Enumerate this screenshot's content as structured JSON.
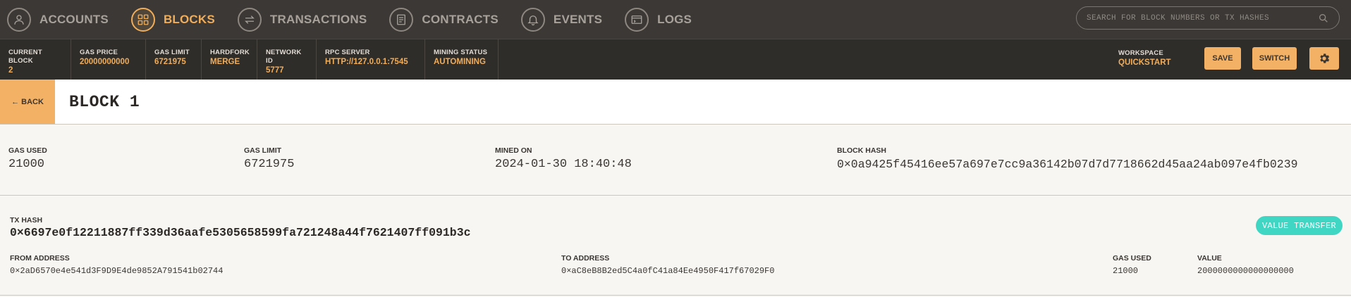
{
  "nav": {
    "items": [
      {
        "label": "ACCOUNTS"
      },
      {
        "label": "BLOCKS"
      },
      {
        "label": "TRANSACTIONS"
      },
      {
        "label": "CONTRACTS"
      },
      {
        "label": "EVENTS"
      },
      {
        "label": "LOGS"
      }
    ],
    "active": "BLOCKS",
    "search_placeholder": "SEARCH FOR BLOCK NUMBERS OR TX HASHES"
  },
  "status": {
    "current_block": {
      "label": "CURRENT BLOCK",
      "value": "2"
    },
    "gas_price": {
      "label": "GAS PRICE",
      "value": "20000000000"
    },
    "gas_limit": {
      "label": "GAS LIMIT",
      "value": "6721975"
    },
    "hardfork": {
      "label": "HARDFORK",
      "value": "MERGE"
    },
    "network_id": {
      "label": "NETWORK ID",
      "value": "5777"
    },
    "rpc_server": {
      "label": "RPC SERVER",
      "value": "HTTP://127.0.0.1:7545"
    },
    "mining_status": {
      "label": "MINING STATUS",
      "value": "AUTOMINING"
    },
    "workspace": {
      "label": "WORKSPACE",
      "value": "QUICKSTART"
    },
    "save_label": "SAVE",
    "switch_label": "SWITCH"
  },
  "block": {
    "back_label": "← BACK",
    "title": "BLOCK 1",
    "gas_used": {
      "label": "GAS USED",
      "value": "21000"
    },
    "gas_limit": {
      "label": "GAS LIMIT",
      "value": "6721975"
    },
    "mined_on": {
      "label": "MINED ON",
      "value": "2024-01-30 18:40:48"
    },
    "block_hash": {
      "label": "BLOCK HASH",
      "value": "0×0a9425f45416ee57a697e7cc9a36142b07d7d7718662d45aa24ab097e4fb0239"
    }
  },
  "transaction": {
    "tx_hash": {
      "label": "TX HASH",
      "value": "0×6697e0f12211887ff339d36aafe5305658599fa721248a44f7621407ff091b3c"
    },
    "type_badge": "VALUE TRANSFER",
    "from": {
      "label": "FROM ADDRESS",
      "value": "0×2aD6570e4e541d3F9D9E4de9852A791541b02744"
    },
    "to": {
      "label": "TO ADDRESS",
      "value": "0×aC8eB8B2ed5C4a0fC41a84Ee4950F417f67029F0"
    },
    "gas_used": {
      "label": "GAS USED",
      "value": "21000"
    },
    "value": {
      "label": "VALUE",
      "value": "2000000000000000000"
    }
  },
  "colors": {
    "accent": "#f0ad5a",
    "nav_bg": "#3b3835",
    "status_bg": "#2f2d2a",
    "badge": "#3fd7c3"
  },
  "icons": {
    "accounts": "person-icon",
    "blocks": "grid-icon",
    "transactions": "arrows-exchange-icon",
    "contracts": "document-icon",
    "events": "bell-icon",
    "logs": "terminal-icon",
    "search": "search-icon",
    "settings": "gear-icon"
  }
}
